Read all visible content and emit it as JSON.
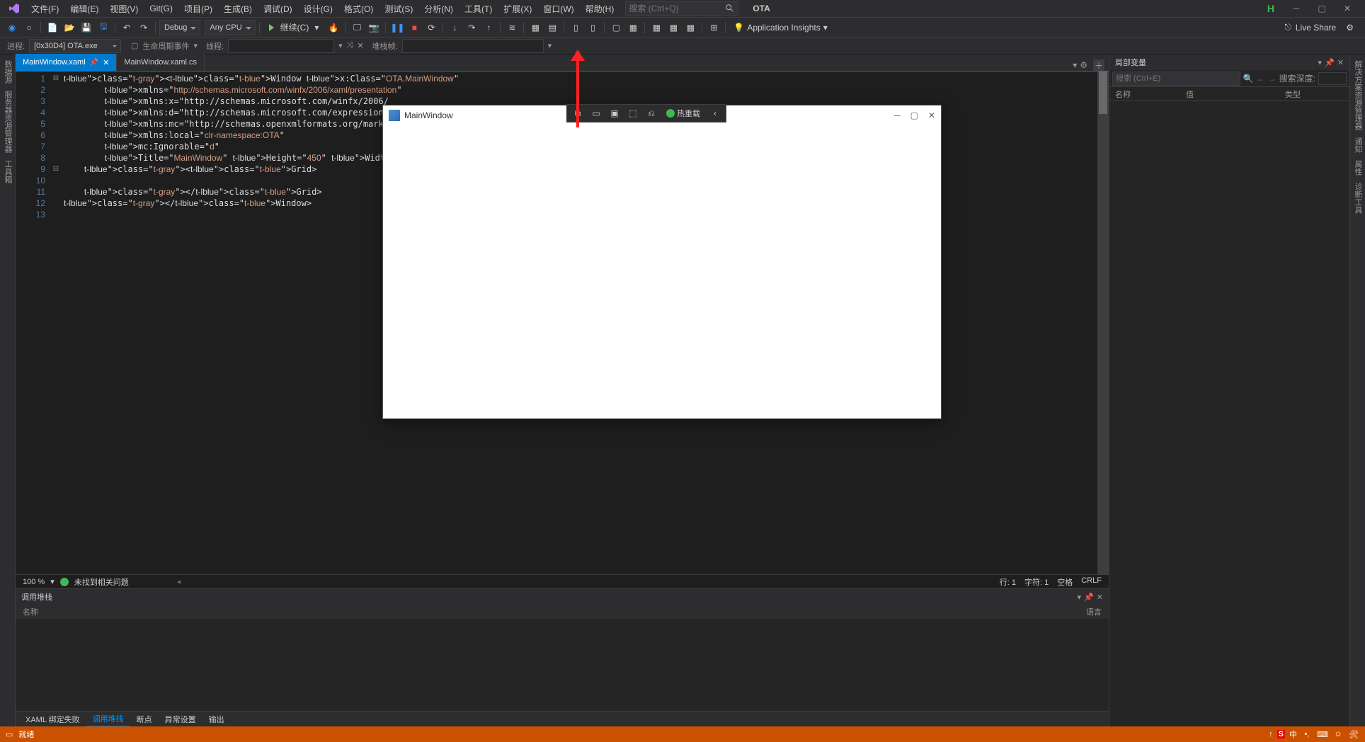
{
  "menubar": {
    "items": [
      "文件(F)",
      "编辑(E)",
      "视图(V)",
      "Git(G)",
      "项目(P)",
      "生成(B)",
      "调试(D)",
      "设计(G)",
      "格式(O)",
      "测试(S)",
      "分析(N)",
      "工具(T)",
      "扩展(X)",
      "窗口(W)",
      "帮助(H)"
    ],
    "search_placeholder": "搜索 (Ctrl+Q)",
    "solution": "OTA",
    "h_badge": "H"
  },
  "toolbar": {
    "config": "Debug",
    "platform": "Any CPU",
    "run_label": "继续(C)",
    "insights": "Application Insights",
    "liveshare": "Live Share"
  },
  "toolbar2": {
    "process_label": "进程:",
    "process_value": "[0x30D4] OTA.exe",
    "lifecycle": "生命周期事件",
    "thread_label": "线程:",
    "stackframe_label": "堆栈帧:"
  },
  "left_vtabs": [
    "数据源",
    "服务器资源管理器",
    "工具箱"
  ],
  "tabs": [
    {
      "title": "MainWindow.xaml",
      "active": true,
      "pinned": true,
      "closable": true
    },
    {
      "title": "MainWindow.xaml.cs",
      "active": false
    }
  ],
  "code_lines": [
    "<Window x:Class=\"OTA.MainWindow\"",
    "        xmlns=\"http://schemas.microsoft.com/winfx/2006/xaml/presentation\"",
    "        xmlns:x=\"http://schemas.microsoft.com/winfx/2006/",
    "        xmlns:d=\"http://schemas.microsoft.com/expression/",
    "        xmlns:mc=\"http://schemas.openxmlformats.org/marku",
    "        xmlns:local=\"clr-namespace:OTA\"",
    "        mc:Ignorable=\"d\"",
    "        Title=\"MainWindow\" Height=\"450\" Width=\"800\">",
    "    <Grid>",
    "",
    "    </Grid>",
    "</Window>",
    ""
  ],
  "statusline": {
    "zoom": "100 %",
    "issues": "未找到相关问题",
    "line": "行: 1",
    "col": "字符: 1",
    "ins": "空格",
    "enc": "CRLF"
  },
  "bottom": {
    "title": "调用堆栈",
    "col_name": "名称",
    "col_lang": "语言",
    "tabs": [
      "XAML 绑定失败",
      "调用堆栈",
      "断点",
      "异常设置",
      "输出"
    ],
    "active_tab": 1
  },
  "right": {
    "title": "局部变量",
    "search_placeholder": "搜索 (Ctrl+E)",
    "depth_label": "搜索深度:",
    "cols": [
      "名称",
      "值",
      "类型"
    ]
  },
  "right_vtabs": [
    "解决方案资源管理器",
    "通知",
    "属性",
    "诊断工具"
  ],
  "statusbar": {
    "ready": "就绪",
    "ime": "中"
  },
  "app_window": {
    "title": "MainWindow"
  },
  "debug_toolbar": {
    "hot_reload": "热重载"
  }
}
